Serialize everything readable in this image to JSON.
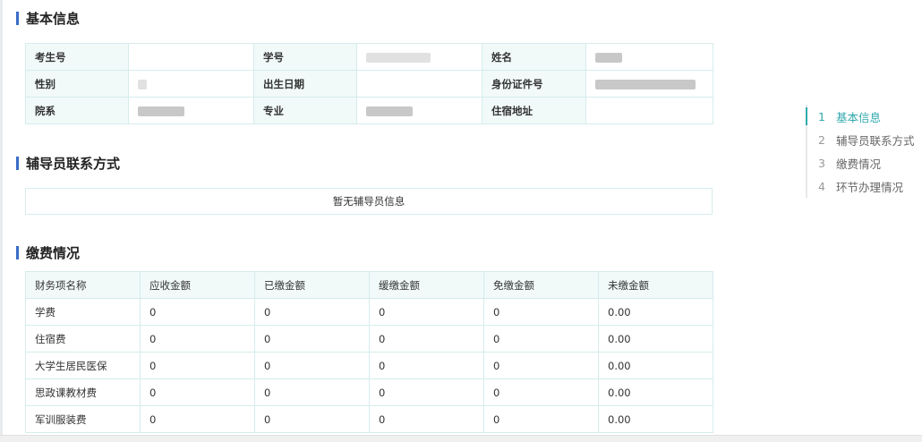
{
  "basic_info": {
    "title": "基本信息",
    "rows": [
      [
        {
          "label": "考生号",
          "value": ""
        },
        {
          "label": "学号",
          "value": ""
        },
        {
          "label": "姓名",
          "value": ""
        }
      ],
      [
        {
          "label": "性别",
          "value": ""
        },
        {
          "label": "出生日期",
          "value": ""
        },
        {
          "label": "身份证件号",
          "value": ""
        }
      ],
      [
        {
          "label": "院系",
          "value": ""
        },
        {
          "label": "专业",
          "value": ""
        },
        {
          "label": "住宿地址",
          "value": ""
        }
      ]
    ]
  },
  "counselor": {
    "title": "辅导员联系方式",
    "empty_text": "暂无辅导员信息"
  },
  "fees": {
    "title": "缴费情况",
    "headers": [
      "财务项名称",
      "应收金额",
      "已缴金额",
      "缓缴金额",
      "免缴金额",
      "未缴金额"
    ],
    "rows": [
      [
        "学费",
        "0",
        "0",
        "0",
        "0",
        "0.00"
      ],
      [
        "住宿费",
        "0",
        "0",
        "0",
        "0",
        "0.00"
      ],
      [
        "大学生居民医保",
        "0",
        "0",
        "0",
        "0",
        "0.00"
      ],
      [
        "思政课教材费",
        "0",
        "0",
        "0",
        "0",
        "0.00"
      ],
      [
        "军训服装费",
        "0",
        "0",
        "0",
        "0",
        "0.00"
      ]
    ]
  },
  "toc": {
    "items": [
      {
        "num": "1",
        "label": "基本信息",
        "active": true
      },
      {
        "num": "2",
        "label": "辅导员联系方式",
        "active": false
      },
      {
        "num": "3",
        "label": "缴费情况",
        "active": false
      },
      {
        "num": "4",
        "label": "环节办理情况",
        "active": false
      }
    ]
  }
}
